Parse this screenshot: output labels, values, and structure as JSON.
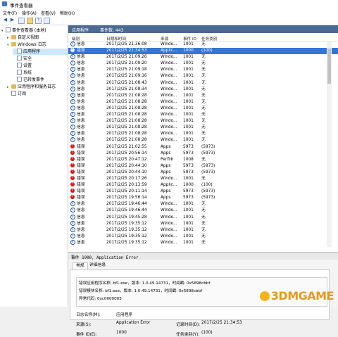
{
  "window": {
    "title": "事件查看器"
  },
  "menu": [
    "文件(F)",
    "操作(A)",
    "查看(V)",
    "帮助(H)"
  ],
  "tree": [
    {
      "label": "事件查看器 (本地)",
      "icon": "event-viewer-icon",
      "arrow": "▾",
      "indent": 0
    },
    {
      "label": "自定义视图",
      "icon": "folder-icon",
      "arrow": "▸",
      "indent": 1
    },
    {
      "label": "Windows 日志",
      "icon": "folder-icon",
      "arrow": "▾",
      "indent": 1
    },
    {
      "label": "应用程序",
      "icon": "log-icon",
      "arrow": "",
      "indent": 2,
      "selected": true
    },
    {
      "label": "安全",
      "icon": "log-icon",
      "arrow": "",
      "indent": 2
    },
    {
      "label": "设置",
      "icon": "log-icon",
      "arrow": "",
      "indent": 2
    },
    {
      "label": "系统",
      "icon": "log-icon",
      "arrow": "",
      "indent": 2
    },
    {
      "label": "已转发事件",
      "icon": "log-icon",
      "arrow": "",
      "indent": 2
    },
    {
      "label": "应用程序和服务日志",
      "icon": "folder-icon",
      "arrow": "▸",
      "indent": 1
    },
    {
      "label": "订阅",
      "icon": "log-icon",
      "arrow": "",
      "indent": 1
    }
  ],
  "panel": {
    "title": "应用程序",
    "count_label": "事件数: 443"
  },
  "columns": {
    "level": "级别",
    "datetime": "日期和时间",
    "source": "来源",
    "event_id": "事件 ID",
    "task": "任务类别"
  },
  "events": [
    {
      "kind": "info",
      "level": "信息",
      "datetime": "2017/2/25 21:36:08",
      "source": "Windo...",
      "event_id": "1001",
      "task": "无"
    },
    {
      "kind": "err",
      "level": "错误",
      "datetime": "2017/2/25 21:34:53",
      "source": "Applic...",
      "event_id": "1000",
      "task": "(100)",
      "selected": true
    },
    {
      "kind": "info",
      "level": "信息",
      "datetime": "2017/2/25 21:09:26",
      "source": "Windo...",
      "event_id": "1001",
      "task": "无"
    },
    {
      "kind": "info",
      "level": "信息",
      "datetime": "2017/2/25 21:09:20",
      "source": "Windo...",
      "event_id": "1001",
      "task": "无"
    },
    {
      "kind": "info",
      "level": "信息",
      "datetime": "2017/2/25 21:09:18",
      "source": "Windo...",
      "event_id": "1001",
      "task": "无"
    },
    {
      "kind": "info",
      "level": "信息",
      "datetime": "2017/2/25 21:09:16",
      "source": "Windo...",
      "event_id": "1001",
      "task": "无"
    },
    {
      "kind": "info",
      "level": "信息",
      "datetime": "2017/2/25 21:08:43",
      "source": "Windo...",
      "event_id": "1001",
      "task": "无"
    },
    {
      "kind": "info",
      "level": "信息",
      "datetime": "2017/2/25 21:08:34",
      "source": "Windo...",
      "event_id": "1001",
      "task": "无"
    },
    {
      "kind": "info",
      "level": "信息",
      "datetime": "2017/2/25 21:08:28",
      "source": "Windo...",
      "event_id": "1001",
      "task": "无"
    },
    {
      "kind": "info",
      "level": "信息",
      "datetime": "2017/2/25 21:08:28",
      "source": "Windo...",
      "event_id": "1001",
      "task": "无"
    },
    {
      "kind": "info",
      "level": "信息",
      "datetime": "2017/2/25 21:08:28",
      "source": "Windo...",
      "event_id": "1001",
      "task": "无"
    },
    {
      "kind": "info",
      "level": "信息",
      "datetime": "2017/2/25 21:08:28",
      "source": "Windo...",
      "event_id": "1001",
      "task": "无"
    },
    {
      "kind": "info",
      "level": "信息",
      "datetime": "2017/2/25 21:08:28",
      "source": "Windo...",
      "event_id": "1001",
      "task": "无"
    },
    {
      "kind": "info",
      "level": "信息",
      "datetime": "2017/2/25 21:08:28",
      "source": "Windo...",
      "event_id": "1001",
      "task": "无"
    },
    {
      "kind": "info",
      "level": "信息",
      "datetime": "2017/2/25 21:08:28",
      "source": "Windo...",
      "event_id": "1001",
      "task": "无"
    },
    {
      "kind": "info",
      "level": "信息",
      "datetime": "2017/2/25 21:08:28",
      "source": "Windo...",
      "event_id": "1001",
      "task": "无"
    },
    {
      "kind": "err",
      "level": "错误",
      "datetime": "2017/2/25 21:02:55",
      "source": "Apps",
      "event_id": "5973",
      "task": "(5973)"
    },
    {
      "kind": "err",
      "level": "错误",
      "datetime": "2017/2/25 20:56:14",
      "source": "Apps",
      "event_id": "5973",
      "task": "(5973)"
    },
    {
      "kind": "err",
      "level": "错误",
      "datetime": "2017/2/25 20:47:12",
      "source": "Perflib",
      "event_id": "1008",
      "task": "无"
    },
    {
      "kind": "err",
      "level": "错误",
      "datetime": "2017/2/25 20:44:10",
      "source": "Apps",
      "event_id": "5973",
      "task": "(5973)"
    },
    {
      "kind": "err",
      "level": "错误",
      "datetime": "2017/2/25 20:44:10",
      "source": "Apps",
      "event_id": "5973",
      "task": "(5973)"
    },
    {
      "kind": "err",
      "level": "错误",
      "datetime": "2017/2/25 20:17:26",
      "source": "Windo...",
      "event_id": "1001",
      "task": "无"
    },
    {
      "kind": "err",
      "level": "错误",
      "datetime": "2017/2/25 20:13:59",
      "source": "Applic...",
      "event_id": "1000",
      "task": "(100)"
    },
    {
      "kind": "err",
      "level": "错误",
      "datetime": "2017/2/25 20:11:14",
      "source": "Apps",
      "event_id": "5973",
      "task": "(5973)"
    },
    {
      "kind": "err",
      "level": "错误",
      "datetime": "2017/2/25 19:56:14",
      "source": "Apps",
      "event_id": "5973",
      "task": "(5973)"
    },
    {
      "kind": "info",
      "level": "信息",
      "datetime": "2017/2/25 19:46:44",
      "source": "Windo...",
      "event_id": "1001",
      "task": "无"
    },
    {
      "kind": "info",
      "level": "信息",
      "datetime": "2017/2/25 19:46:44",
      "source": "Windo...",
      "event_id": "1001",
      "task": "无"
    },
    {
      "kind": "info",
      "level": "信息",
      "datetime": "2017/2/25 19:45:28",
      "source": "Windo...",
      "event_id": "1001",
      "task": "无"
    },
    {
      "kind": "info",
      "level": "信息",
      "datetime": "2017/2/25 19:35:12",
      "source": "Windo...",
      "event_id": "1001",
      "task": "无"
    },
    {
      "kind": "info",
      "level": "信息",
      "datetime": "2017/2/25 19:35:12",
      "source": "Windo...",
      "event_id": "1001",
      "task": "无"
    },
    {
      "kind": "info",
      "level": "信息",
      "datetime": "2017/2/25 19:35:12",
      "source": "Windo...",
      "event_id": "1001",
      "task": "无"
    },
    {
      "kind": "info",
      "level": "信息",
      "datetime": "2017/2/25 19:35:12",
      "source": "Windo...",
      "event_id": "1001",
      "task": "无"
    }
  ],
  "detail": {
    "header": "事件 1000, Application Error",
    "tabs": [
      "常规",
      "详细信息"
    ],
    "message_lines": [
      "错误应用程序名称: bf1.exe，版本: 1.0.49.14731，时间戳: 0x5898cbbf",
      "错误模块名称: bf1.exe，版本: 1.0.49.14731，时间戳: 0x5898cbbf",
      "异常代码: 0xc0000005"
    ],
    "log_name_label": "日志名称(M):",
    "log_name_value": "应用程序",
    "source_label": "来源(S):",
    "source_value": "Application Error",
    "recorded_label": "记录时间(D):",
    "recorded_value": "2017/2/25 21:34:53",
    "event_id_label": "事件 ID(E):",
    "event_id_value": "1000",
    "task_label": "任务类别(Y):",
    "task_value": "(100)"
  },
  "watermark": "3DMGAME",
  "colors": {
    "selection": "#3276d6",
    "panel_header": "#4a6a92",
    "error": "#d01b1b",
    "info": "#1a4fa0"
  }
}
